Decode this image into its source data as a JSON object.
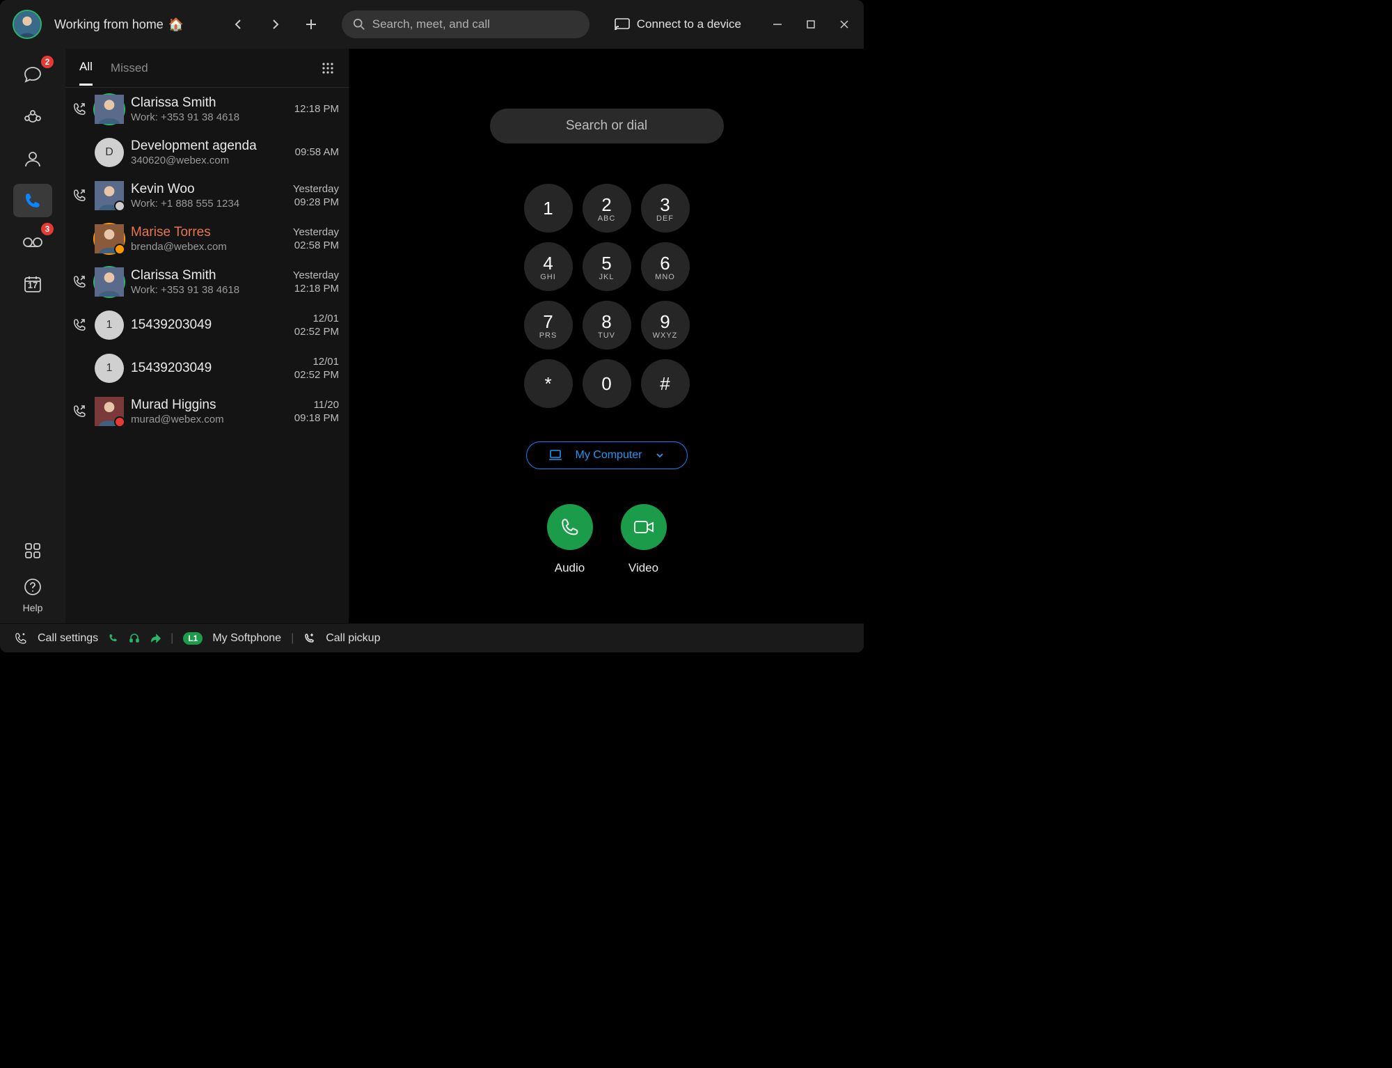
{
  "header": {
    "status": "Working from home",
    "house_emoji": "🏠",
    "search_placeholder": "Search, meet, and call",
    "connect_label": "Connect to a device"
  },
  "rail": {
    "chat_badge": "2",
    "voicemail_badge": "3",
    "calendar_day": "17",
    "help_label": "Help"
  },
  "tabs": {
    "all": "All",
    "missed": "Missed"
  },
  "calls": [
    {
      "name": "Clarissa Smith",
      "sub": "Work: +353 91 38 4618",
      "t1": "",
      "t2": "12:18 PM",
      "icon": "outgoing",
      "avatar": "photo-green",
      "missed": false
    },
    {
      "name": "Development agenda",
      "sub": "340620@webex.com",
      "t1": "",
      "t2": "09:58 AM",
      "icon": "",
      "avatar": "letter",
      "letter": "D",
      "missed": false
    },
    {
      "name": "Kevin Woo",
      "sub": "Work: +1 888 555 1234",
      "t1": "Yesterday",
      "t2": "09:28 PM",
      "icon": "outgoing",
      "avatar": "photo-clock",
      "missed": false
    },
    {
      "name": "Marise Torres",
      "sub": "brenda@webex.com",
      "t1": "Yesterday",
      "t2": "02:58 PM",
      "icon": "",
      "avatar": "photo-orange",
      "missed": true
    },
    {
      "name": "Clarissa Smith",
      "sub": "Work: +353 91 38 4618",
      "t1": "Yesterday",
      "t2": "12:18 PM",
      "icon": "outgoing",
      "avatar": "photo-green",
      "missed": false
    },
    {
      "name": "15439203049",
      "sub": "",
      "t1": "12/01",
      "t2": "02:52 PM",
      "icon": "outgoing",
      "avatar": "letter",
      "letter": "1",
      "missed": false
    },
    {
      "name": "15439203049",
      "sub": "",
      "t1": "12/01",
      "t2": "02:52 PM",
      "icon": "",
      "avatar": "letter",
      "letter": "1",
      "missed": false
    },
    {
      "name": "Murad Higgins",
      "sub": "murad@webex.com",
      "t1": "11/20",
      "t2": "09:18 PM",
      "icon": "outgoing",
      "avatar": "photo-dnd",
      "missed": false
    }
  ],
  "dialer": {
    "search_placeholder": "Search or dial",
    "keys": [
      {
        "d": "1",
        "l": ""
      },
      {
        "d": "2",
        "l": "ABC"
      },
      {
        "d": "3",
        "l": "DEF"
      },
      {
        "d": "4",
        "l": "GHI"
      },
      {
        "d": "5",
        "l": "JKL"
      },
      {
        "d": "6",
        "l": "MNO"
      },
      {
        "d": "7",
        "l": "PRS"
      },
      {
        "d": "8",
        "l": "TUV"
      },
      {
        "d": "9",
        "l": "WXYZ"
      },
      {
        "d": "*",
        "l": ""
      },
      {
        "d": "0",
        "l": ""
      },
      {
        "d": "#",
        "l": ""
      }
    ],
    "device": "My Computer",
    "audio_label": "Audio",
    "video_label": "Video"
  },
  "footer": {
    "call_settings": "Call settings",
    "line_badge": "L1",
    "softphone": "My Softphone",
    "pickup": "Call pickup"
  }
}
